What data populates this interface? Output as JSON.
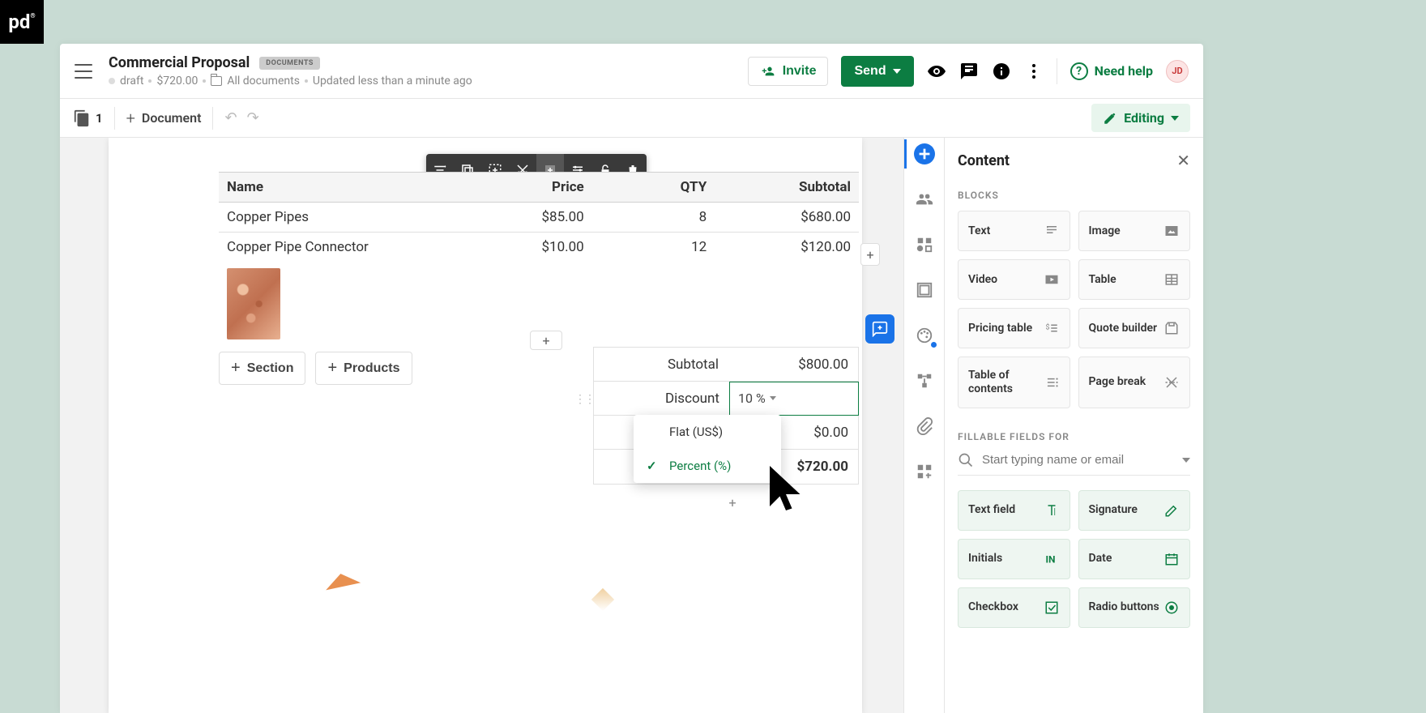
{
  "header": {
    "title": "Commercial Proposal",
    "badge": "DOCUMENTS",
    "status": "draft",
    "total": "$720.00",
    "folder": "All documents",
    "updated": "Updated less than a minute ago",
    "invite": "Invite",
    "send": "Send",
    "help": "Need help",
    "avatar": "JD"
  },
  "toolbar": {
    "pages": "1",
    "document": "Document",
    "editing": "Editing"
  },
  "table": {
    "headers": {
      "name": "Name",
      "price": "Price",
      "qty": "QTY",
      "subtotal": "Subtotal"
    },
    "rows": [
      {
        "name": "Copper Pipes",
        "price": "$85.00",
        "qty": "8",
        "subtotal": "$680.00"
      },
      {
        "name": "Copper Pipe Connector",
        "price": "$10.00",
        "qty": "12",
        "subtotal": "$120.00"
      }
    ],
    "add_section": "Section",
    "add_products": "Products"
  },
  "totals": {
    "subtotal_label": "Subtotal",
    "subtotal_value": "$800.00",
    "discount_label": "Discount",
    "discount_value": "10 %",
    "tax_value": "$0.00",
    "total_value": "$720.00"
  },
  "dropdown": {
    "flat": "Flat (US$)",
    "percent": "Percent (%)"
  },
  "panel": {
    "title": "Content",
    "blocks_label": "BLOCKS",
    "blocks": {
      "text": "Text",
      "image": "Image",
      "video": "Video",
      "table": "Table",
      "pricing": "Pricing table",
      "quote": "Quote builder",
      "toc": "Table of contents",
      "pagebreak": "Page break"
    },
    "fillable_label": "FILLABLE FIELDS FOR",
    "search_placeholder": "Start typing name or email",
    "fields": {
      "text": "Text field",
      "signature": "Signature",
      "initials": "Initials",
      "date": "Date",
      "checkbox": "Checkbox",
      "radio": "Radio buttons"
    }
  }
}
